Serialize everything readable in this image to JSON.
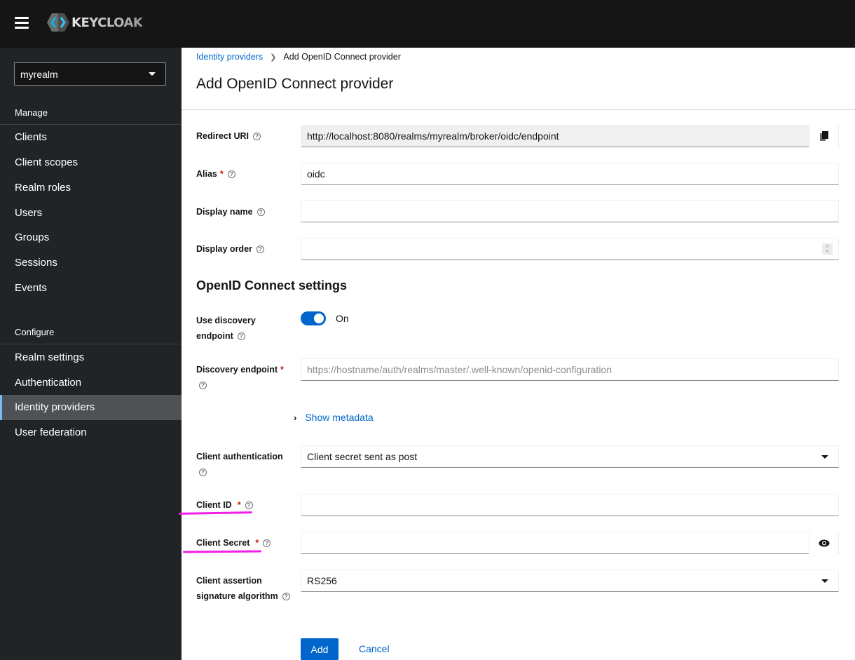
{
  "masthead": {
    "brand": "KEYCLOAK",
    "brand_colors": {
      "background": "#151515",
      "icon_accent": "#00b9e4"
    }
  },
  "sidebar": {
    "realm_select": {
      "value": "myrealm"
    },
    "sections": [
      {
        "title": "Manage",
        "items": [
          {
            "label": "Clients"
          },
          {
            "label": "Client scopes"
          },
          {
            "label": "Realm roles"
          },
          {
            "label": "Users"
          },
          {
            "label": "Groups"
          },
          {
            "label": "Sessions"
          },
          {
            "label": "Events"
          }
        ]
      },
      {
        "title": "Configure",
        "items": [
          {
            "label": "Realm settings"
          },
          {
            "label": "Authentication"
          },
          {
            "label": "Identity providers",
            "active": true
          },
          {
            "label": "User federation"
          }
        ]
      }
    ],
    "active_accent": "#73bcf7"
  },
  "header": {
    "breadcrumb": [
      {
        "label": "Identity providers",
        "link": true
      },
      {
        "label": "Add OpenID Connect provider",
        "link": false
      }
    ],
    "title": "Add OpenID Connect provider"
  },
  "form": {
    "redirect_uri": {
      "label": "Redirect URI",
      "value": "http://localhost:8080/realms/myrealm/broker/oidc/endpoint",
      "copy_icon": "copy-icon"
    },
    "alias": {
      "label": "Alias",
      "required": true,
      "value": "oidc"
    },
    "display_name": {
      "label": "Display name",
      "value": ""
    },
    "display_order": {
      "label": "Display order",
      "value": ""
    },
    "oidc_section_title": "OpenID Connect settings",
    "use_discovery": {
      "label_line1": "Use discovery",
      "label_line2": "endpoint",
      "state": "On",
      "enabled": true
    },
    "discovery_endpoint": {
      "label": "Discovery endpoint",
      "required": true,
      "value": "",
      "placeholder": "https://hostname/auth/realms/master/.well-known/openid-configuration"
    },
    "show_metadata": {
      "label": "Show metadata"
    },
    "client_authentication": {
      "label": "Client authentication",
      "value": "Client secret sent as post"
    },
    "client_id": {
      "label": "Client ID",
      "required": true,
      "value": ""
    },
    "client_secret": {
      "label": "Client Secret",
      "required": true,
      "value": "",
      "reveal_icon": "eye-icon"
    },
    "client_assertion_alg": {
      "label_line1": "Client assertion",
      "label_line2": "signature algorithm",
      "value": "RS256"
    },
    "help_icon_glyph": "?",
    "required_marker": "*"
  },
  "actions": {
    "add_label": "Add",
    "cancel_label": "Cancel",
    "primary_color": "#0066cc"
  },
  "annotations": {
    "highlight_color": "#f020e8",
    "highlighted_fields": [
      "Client ID",
      "Client Secret"
    ]
  }
}
